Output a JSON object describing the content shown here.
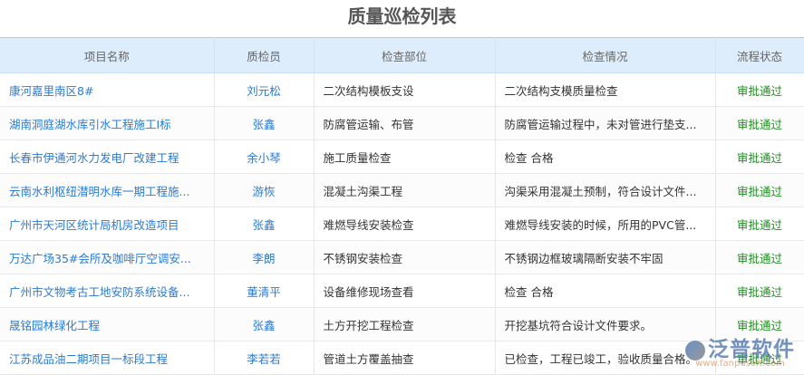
{
  "title": "质量巡检列表",
  "columns": [
    "项目名称",
    "质检员",
    "检查部位",
    "检查情况",
    "流程状态"
  ],
  "rows": [
    {
      "project": "康河嘉里南区8#",
      "inspector": "刘元松",
      "part": "二次结构模板支设",
      "situation": "二次结构支模质量检查",
      "status": "审批通过"
    },
    {
      "project": "湖南洞庭湖水库引水工程施工I标",
      "inspector": "张鑫",
      "part": "防腐管运输、布管",
      "situation": "防腐管运输过程中，未对管进行垫支...",
      "status": "审批通过"
    },
    {
      "project": "长春市伊通河水力发电厂改建工程",
      "inspector": "余小琴",
      "part": "施工质量检查",
      "situation": "检查 合格",
      "status": "审批通过"
    },
    {
      "project": "云南水利枢纽潜明水库一期工程施...",
      "inspector": "游恢",
      "part": "混凝土沟渠工程",
      "situation": "沟渠采用混凝土预制，符合设计文件...",
      "status": "审批通过"
    },
    {
      "project": "广州市天河区统计局机房改造项目",
      "inspector": "张鑫",
      "part": "难燃导线安装检查",
      "situation": "难燃导线安装的时候，所用的PVC管...",
      "status": "审批通过"
    },
    {
      "project": "万达广场35#会所及咖啡厅空调安...",
      "inspector": "李朗",
      "part": "不锈钢安装检查",
      "situation": "不锈钢边框玻璃隔断安装不牢固",
      "status": "审批通过"
    },
    {
      "project": "广州市文物考古工地安防系统设备...",
      "inspector": "董清平",
      "part": "设备维修现场查看",
      "situation": "检查 合格",
      "status": "审批通过"
    },
    {
      "project": "晟铭园林绿化工程",
      "inspector": "张鑫",
      "part": "土方开挖工程检查",
      "situation": "开挖基坑符合设计文件要求。",
      "status": "审批通过"
    },
    {
      "project": "江苏成品油二期项目一标段工程",
      "inspector": "李若若",
      "part": "管道土方覆盖抽查",
      "situation": "已检查，工程已竣工，验收质量合格。",
      "status": "审批通过"
    }
  ],
  "watermark": {
    "brand": "泛普软件",
    "url": "www.fanpusoft.com"
  }
}
